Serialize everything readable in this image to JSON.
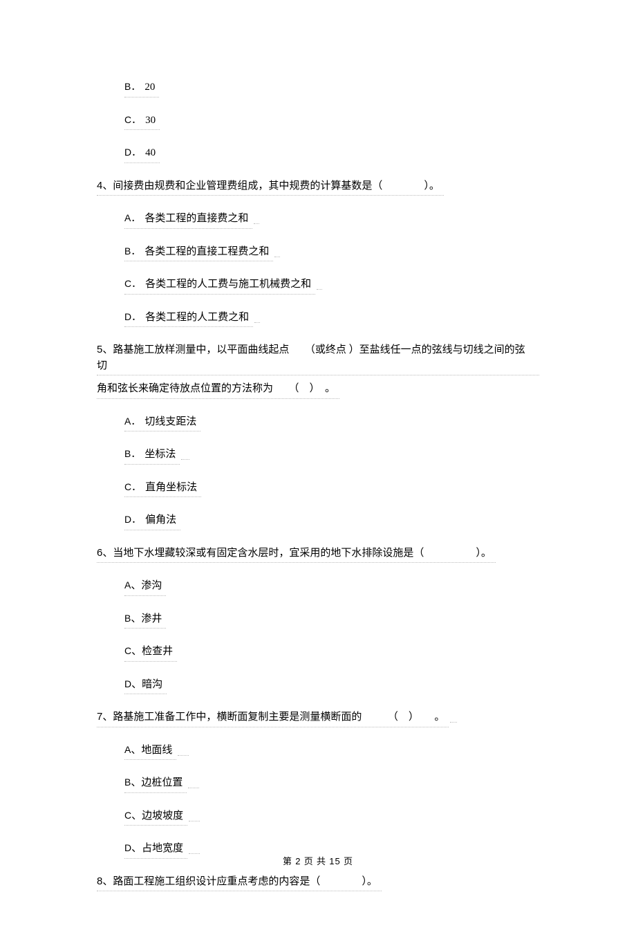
{
  "q3": {
    "optB_letter": "B．",
    "optB_text": "20",
    "optC_letter": "C．",
    "optC_text": "30",
    "optD_letter": "D．",
    "optD_text": "40"
  },
  "q4": {
    "num": "4",
    "text": "、间接费由规费和企业管理费组成，其中规费的计算基数是（　　　　）。",
    "optA_letter": "A．",
    "optA_text": "各类工程的直接费之和",
    "optB_letter": "B．",
    "optB_text": "各类工程的直接工程费之和",
    "optC_letter": "C．",
    "optC_text": "各类工程的人工费与施工机械费之和",
    "optD_letter": "D．",
    "optD_text": "各类工程的人工费之和"
  },
  "q5": {
    "num": "5",
    "line1": "、路基施工放样测量中，以平面曲线起点　　（或终点 ）至盐线任一点的弦线与切线之间的弦切",
    "line2": "角和弦长来确定待放点位置的方法称为　　（　）　。",
    "optA_letter": "A．",
    "optA_text": "切线支距法",
    "optB_letter": "B．",
    "optB_text": "坐标法",
    "optC_letter": "C．",
    "optC_text": "直角坐标法",
    "optD_letter": "D．",
    "optD_text": "偏角法"
  },
  "q6": {
    "num": "6",
    "text": "、当地下水埋藏较深或有固定含水层时，宜采用的地下水排除设施是（　　　　　）。",
    "optA_letter": "A",
    "optA_text": "、渗沟",
    "optB_letter": "B",
    "optB_text": "、渗井",
    "optC_letter": "C",
    "optC_text": "、检查井",
    "optD_letter": "D",
    "optD_text": "、暗沟"
  },
  "q7": {
    "num": "7",
    "text": "、路基施工准备工作中，横断面复制主要是测量横断面的　　　（　）　　。",
    "optA_letter": "A",
    "optA_text": "、地面线",
    "optB_letter": "B",
    "optB_text": "、边桩位置",
    "optC_letter": "C",
    "optC_text": "、边坡坡度",
    "optD_letter": "D",
    "optD_text": "、占地宽度"
  },
  "q8": {
    "num": "8",
    "text": "、路面工程施工组织设计应重点考虑的内容是（　　　　）。"
  },
  "footer": {
    "prefix": "第 ",
    "page": "2",
    "mid": " 页 共 ",
    "total": "15",
    "suffix": " 页"
  }
}
